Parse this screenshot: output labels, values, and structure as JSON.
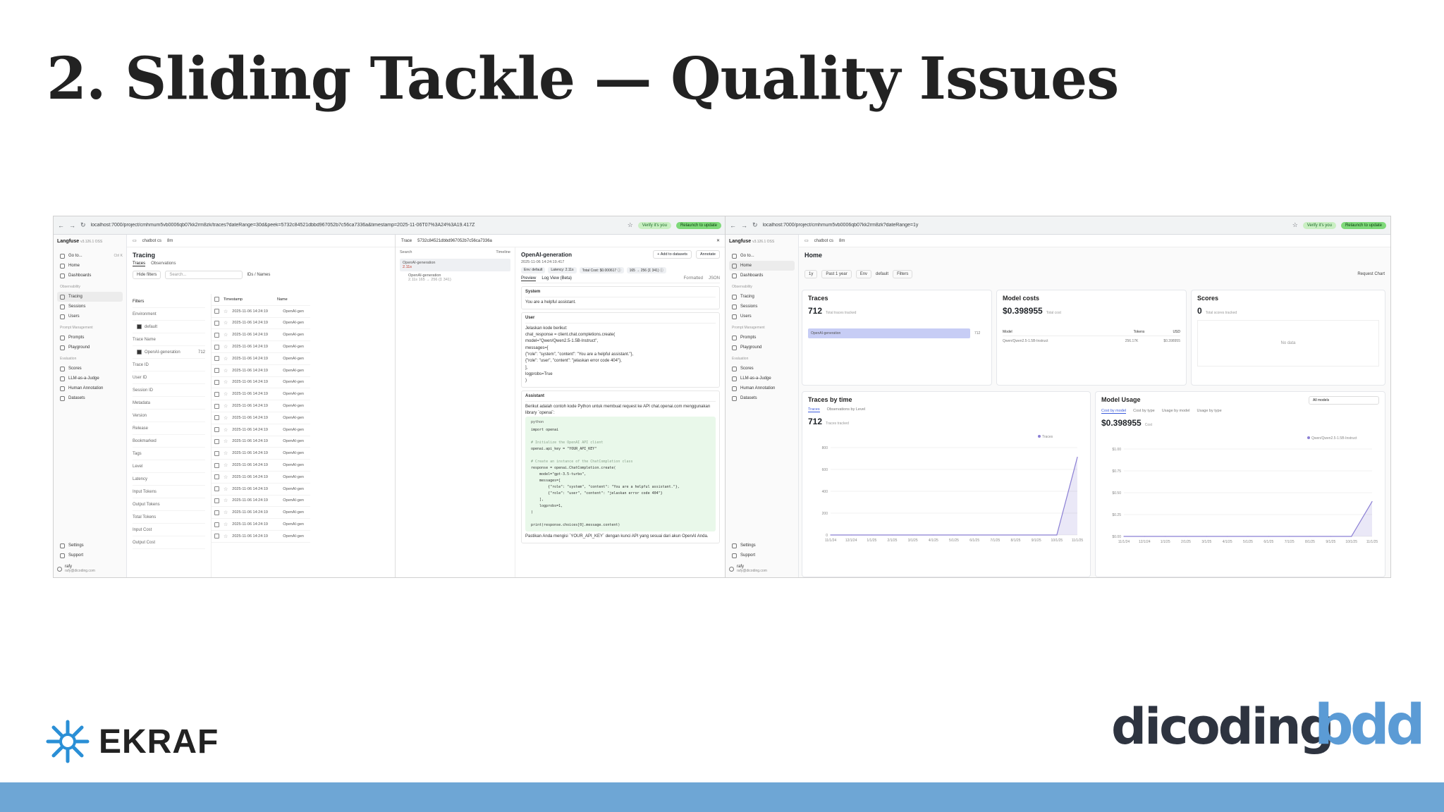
{
  "slide": {
    "title": "2. Sliding Tackle — Quality Issues",
    "brand_left": "EKRAF",
    "brand_right_1": "dicoding",
    "brand_right_2": "bdd",
    "band_color": "#6ea6d5"
  },
  "left_window": {
    "url": "localhost:7000/project/cmhmum5vb0006qb07kk2rm8zk/traces?dateRange=30d&peek=5732c84521dbbd967052b7c56ca7336a&timestamp=2025-11-06T07%3A24%3A19.417Z",
    "verify": "Verify it's you",
    "relaunch": "Relaunch to update",
    "app_name": "Langfuse",
    "app_version": "v3.126.1 OSS",
    "project": "chatbot cs",
    "env": "8m",
    "sidebar": {
      "goto": "Go to...",
      "goto_shortcut": "Ctrl K",
      "items_top": [
        "Home",
        "Dashboards"
      ],
      "group_observability": "Observability",
      "items_obs": [
        "Tracing",
        "Sessions",
        "Users"
      ],
      "group_prompt": "Prompt Management",
      "items_prompt": [
        "Prompts",
        "Playground"
      ],
      "group_eval": "Evaluation",
      "items_eval": [
        "Scores",
        "LLM-as-a-Judge",
        "Human Annotation",
        "Datasets"
      ],
      "settings": "Settings",
      "support": "Support",
      "user_name": "rafy",
      "user_email": "rafy@dicoding.com"
    },
    "page_title": "Tracing",
    "tabs": [
      "Traces",
      "Observations"
    ],
    "hide_filters": "Hide filters",
    "search_placeholder": "Search...",
    "ids_names": "IDs / Names",
    "filters_label": "Filters",
    "filter_rows": [
      "Environment",
      "Trace Name",
      "Trace ID",
      "User ID",
      "Session ID",
      "Metadata",
      "Version",
      "Release",
      "Bookmarked",
      "Tags",
      "Level",
      "Latency",
      "Input Tokens",
      "Output Tokens",
      "Total Tokens",
      "Input Cost",
      "Output Cost"
    ],
    "env_value": "default",
    "trace_name_value": "OpenAI-generation",
    "trace_name_count": "712",
    "col_timestamp": "Timestamp",
    "col_name": "Name",
    "row_timestamp": "2025-11-06 14:24:19",
    "row_name": "OpenAI-gen",
    "trace_label": "Trace",
    "trace_id": "5732c84521dbbd967052b7c56ca7336a",
    "search_label": "Search",
    "timeline": "Timeline",
    "tree_node_1": "OpenAI-generation",
    "tree_node_1_time": "2.11s",
    "tree_node_2": "OpenAI-generation",
    "tree_node_2_meta": "2.11s   165 → 256 (Σ 341)",
    "detail_title": "OpenAI-generation",
    "add_datasets": "+ Add to datasets",
    "annotate": "Annotate",
    "detail_timestamp": "2025-11-06 14:24:19.417",
    "badges": [
      "Env: default",
      "Latency: 2.11s",
      "Total Cost: $0.000617 ⓘ",
      "165 → 256 (Σ 341) ⓘ"
    ],
    "view_tabs": [
      "Preview",
      "Log View (Beta)"
    ],
    "formatted": "Formatted",
    "json": "JSON",
    "system_label": "System",
    "system_text": "You are a helpful assistant.",
    "user_label": "User",
    "user_lines": [
      "Jelaskan kode berikut:",
      "chat_response = client.chat.completions.create(",
      "model=\"Qwen/Qwen2.5-1.5B-Instruct\",",
      "messages=[",
      "{\"role\": \"system\", \"content\": \"You are a helpful assistant.\"},",
      "{\"role\": \"user\", \"content\": \"jelaskan error code 404\"},",
      "],",
      "logprobs=True",
      ")"
    ],
    "assistant_label": "Assistant",
    "assistant_intro": "Berikut adalah contoh kode Python untuk membuat request ke API chat.openai.com menggunakan library `openai`:",
    "code_lang": "python",
    "code_lines": [
      "import openai",
      "",
      "# Initialize the OpenAI API client",
      "openai.api_key = \"YOUR_API_KEY\"",
      "",
      "# Create an instance of the ChatCompletion class",
      "response = openai.ChatCompletion.create(",
      "    model=\"gpt-3.5-turbo\",",
      "    messages=[",
      "        {\"role\": \"system\", \"content\": \"You are a helpful assistant.\"},",
      "        {\"role\": \"user\", \"content\": \"jelaskan error code 404\"}",
      "    ],",
      "    logprobs=1,",
      ")",
      "",
      "print(response.choices[0].message.content)"
    ],
    "assistant_outro": "Pastikan Anda mengisi `YOUR_API_KEY` dengan kunci API yang sesuai dari akun OpenAI Anda."
  },
  "right_window": {
    "url": "localhost:7000/project/cmhmum5vb0006qb07kk2rm8zk?dateRange=1y",
    "verify": "Verify it's you",
    "relaunch": "Relaunch to update",
    "page_title": "Home",
    "range_short": "1y",
    "range_long": "Past 1 year",
    "env_label": "Env",
    "env_value": "default",
    "filters": "Filters",
    "request_chart": "Request Chart",
    "traces_card": {
      "title": "Traces",
      "value": "712",
      "caption": "Total traces tracked",
      "bar_label": "OpenAI-generation",
      "bar_value": "712"
    },
    "cost_card": {
      "title": "Model costs",
      "value": "$0.398955",
      "caption": "Total cost",
      "cols": [
        "Model",
        "Tokens",
        "USD"
      ],
      "row": [
        "Qwen/Qwen2.5-1.5B-Instruct",
        "256.17K",
        "$0.398955"
      ]
    },
    "scores_card": {
      "title": "Scores",
      "value": "0",
      "caption": "Total scores tracked",
      "empty": "No data"
    },
    "tbt_card": {
      "title": "Traces by time",
      "tabs": [
        "Traces",
        "Observations by Level"
      ],
      "value": "712",
      "caption": "Traces tracked",
      "legend": "Traces"
    },
    "usage_card": {
      "title": "Model Usage",
      "select": "All models",
      "tabs": [
        "Cost by model",
        "Cost by type",
        "Usage by model",
        "Usage by type"
      ],
      "value": "$0.398955",
      "caption": "Cost",
      "legend": "Qwen/Qwen2.5-1.5B-Instruct"
    }
  },
  "chart_data": [
    {
      "type": "area",
      "title": "Traces by time",
      "x": [
        "11/1/24",
        "12/1/24",
        "1/1/25",
        "2/1/25",
        "3/1/25",
        "4/1/25",
        "5/1/25",
        "6/1/25",
        "7/1/25",
        "8/1/25",
        "9/1/25",
        "10/1/25",
        "11/1/25"
      ],
      "y_ticks": [
        "0",
        "200",
        "400",
        "600",
        "800"
      ],
      "ylim": [
        0,
        800
      ],
      "series": [
        {
          "name": "Traces",
          "values": [
            0,
            0,
            0,
            0,
            0,
            0,
            0,
            0,
            0,
            0,
            0,
            0,
            712
          ]
        }
      ],
      "color": "#8b7fd4"
    },
    {
      "type": "area",
      "title": "Model Usage",
      "x": [
        "11/1/24",
        "12/1/24",
        "1/1/25",
        "2/1/25",
        "3/1/25",
        "4/1/25",
        "5/1/25",
        "6/1/25",
        "7/1/25",
        "8/1/25",
        "9/1/25",
        "10/1/25",
        "11/1/25"
      ],
      "y_ticks": [
        "$0.00",
        "$0.25",
        "$0.50",
        "$0.75",
        "$1.00"
      ],
      "ylim": [
        0,
        1
      ],
      "series": [
        {
          "name": "Qwen/Qwen2.5-1.5B-Instruct",
          "values": [
            0,
            0,
            0,
            0,
            0,
            0,
            0,
            0,
            0,
            0,
            0,
            0,
            0.398955
          ]
        }
      ],
      "color": "#8b7fd4"
    }
  ]
}
